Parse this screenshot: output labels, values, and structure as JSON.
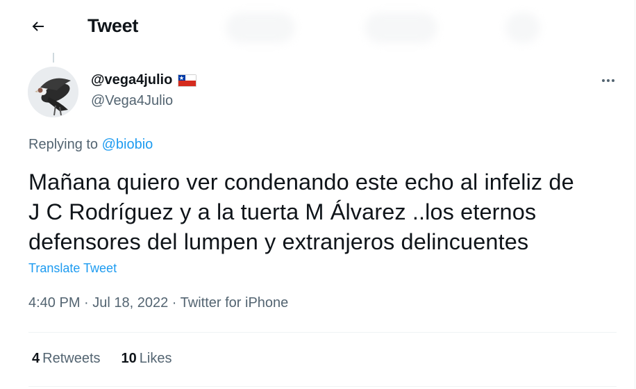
{
  "header": {
    "title": "Tweet"
  },
  "tweet": {
    "display_name": "@vega4julio",
    "handle": "@Vega4Julio",
    "flag": "flag-chile-icon",
    "replying_prefix": "Replying to",
    "replying_to": "@biobio",
    "text_lines": [
      "Mañana quiero ver condenando este echo al infeliz de",
      "J C Rodríguez y a la tuerta M Álvarez ..los eternos",
      "defensores del lumpen y extranjeros delincuentes"
    ],
    "translate_label": "Translate Tweet",
    "time": "4:40 PM",
    "separator": " · ",
    "date": "Jul 18, 2022",
    "source": "Twitter for iPhone",
    "retweets_count": "4",
    "retweets_label": "Retweets",
    "likes_count": "10",
    "likes_label": "Likes"
  },
  "colors": {
    "link": "#1d9bf0",
    "secondary": "#536471",
    "primary": "#0f1419",
    "border": "#eff3f4"
  }
}
